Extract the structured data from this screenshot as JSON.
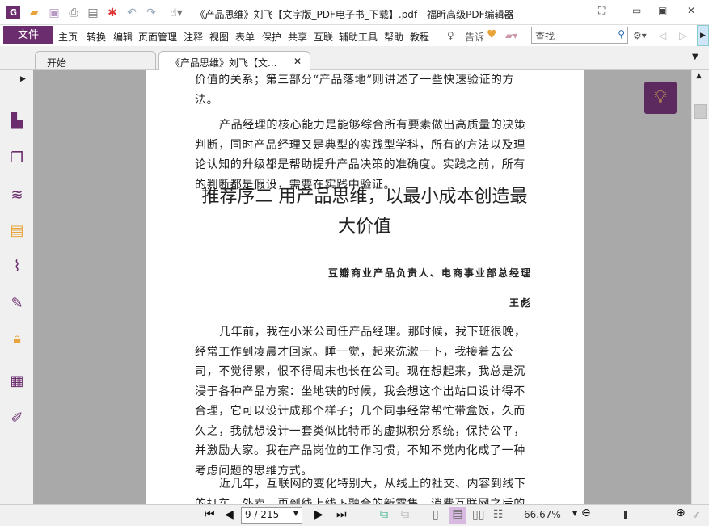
{
  "window": {
    "title": "《产品思维》刘飞【文字版_PDF电子书_下载】.pdf - 福昕高级PDF编辑器"
  },
  "menu": {
    "file": "文件",
    "items": [
      "主页",
      "转换",
      "编辑",
      "页面管理",
      "注释",
      "视图",
      "表单",
      "保护",
      "共享",
      "互联",
      "辅助工具",
      "帮助",
      "教程"
    ],
    "tell": "告诉",
    "search_placeholder": "查找"
  },
  "tabs": [
    {
      "label": "开始"
    },
    {
      "label": "《产品思维》刘飞【文..."
    }
  ],
  "document": {
    "p1": "价值的关系；第三部分“产品落地”则讲述了一些快速验证的方法。",
    "p2": "产品经理的核心能力是能够综合所有要素做出高质量的决策判断，同时产品经理又是典型的实践型学科，所有的方法以及理论认知的升级都是帮助提升产品决策的准确度。实践之前，所有的判断都是假设，需要在实践中验证。",
    "heading": "推荐序二 用产品思维，以最小成本创造最大价值",
    "author_title": "豆瓣商业产品负责人、电商事业部总经理",
    "author": "王彪",
    "p3": "几年前，我在小米公司任产品经理。那时候，我下班很晚，经常工作到凌晨才回家。睡一觉，起来洗漱一下，我接着去公司，不觉得累，恨不得周末也长在公司。现在想起来，我总是沉浸于各种产品方案：坐地铁的时候，我会想这个出站口设计得不合理，它可以设计成那个样子；几个同事经常帮忙带盒饭，久而久之，我就想设计一套类似比特币的虚拟积分系统，保持公平，并激励大家。我在产品岗位的工作习惯，不知不觉内化成了一种考虑问题的思维方式。",
    "p4": "近几年，互联网的变化特别大，从线上的社交、内容到线下的打车、外卖，再到线上线下融合的新零售，消费互联网之后的"
  },
  "statusbar": {
    "page": "9 / 215",
    "zoom": "66.67%",
    "zoom_level_percent": 66.67
  },
  "colors": {
    "accent": "#6b2d6e",
    "bulb": "#5d2a5f"
  }
}
